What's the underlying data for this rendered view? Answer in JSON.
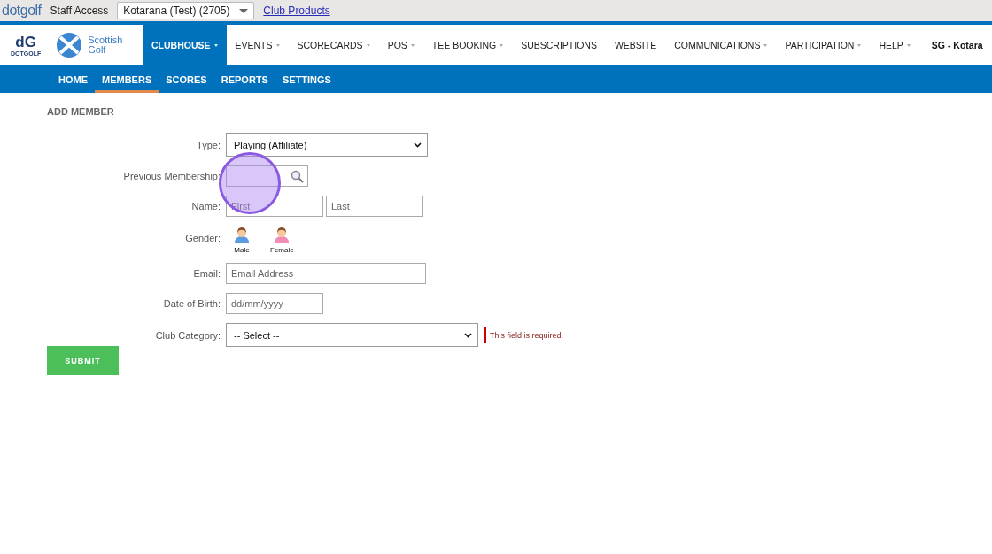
{
  "top_bar": {
    "logo": "dotgolf",
    "label": "Staff Access",
    "club_select": {
      "value": "Kotarana (Test) (2705)"
    },
    "link": "Club Products"
  },
  "main_nav": {
    "brand": {
      "mark": "dG",
      "mark_caption": "DOTGOLF",
      "partner": "Scottish Golf"
    },
    "items": [
      {
        "label": "CLUBHOUSE",
        "selected": true,
        "caret": true
      },
      {
        "label": "EVENTS",
        "selected": false,
        "caret": true
      },
      {
        "label": "SCORECARDS",
        "selected": false,
        "caret": true
      },
      {
        "label": "POS",
        "selected": false,
        "caret": true
      },
      {
        "label": "TEE BOOKING",
        "selected": false,
        "caret": true
      },
      {
        "label": "SUBSCRIPTIONS",
        "selected": false,
        "caret": false
      },
      {
        "label": "WEBSITE",
        "selected": false,
        "caret": false
      },
      {
        "label": "COMMUNICATIONS",
        "selected": false,
        "caret": true
      },
      {
        "label": "PARTICIPATION",
        "selected": false,
        "caret": true
      },
      {
        "label": "HELP",
        "selected": false,
        "caret": true
      }
    ],
    "user": "SG - Kotara"
  },
  "sub_nav": [
    {
      "label": "HOME",
      "selected": false
    },
    {
      "label": "MEMBERS",
      "selected": true
    },
    {
      "label": "SCORES",
      "selected": false
    },
    {
      "label": "REPORTS",
      "selected": false
    },
    {
      "label": "SETTINGS",
      "selected": false
    }
  ],
  "form": {
    "title": "ADD MEMBER",
    "fields": [
      {
        "kind": "select",
        "label": "Type:",
        "value": "Playing (Affiliate)"
      },
      {
        "kind": "search",
        "label": "Previous Membership:"
      },
      {
        "kind": "name",
        "label": "Name:",
        "inputs": [
          {
            "placeholder": "First"
          },
          {
            "placeholder": "Last"
          }
        ]
      },
      {
        "kind": "gender",
        "label": "Gender:",
        "options": [
          {
            "label": "Male",
            "kind": "male"
          },
          {
            "label": "Female",
            "kind": "female"
          }
        ]
      },
      {
        "kind": "text",
        "label": "Email:",
        "placeholder": "Email Address"
      },
      {
        "kind": "date",
        "label": "Date of Birth:",
        "placeholder": "dd/mm/yyyy"
      },
      {
        "kind": "select",
        "label": "Club Category:",
        "value": "-- Select --",
        "error": "This field is required."
      }
    ],
    "submit": "SUBMIT"
  }
}
